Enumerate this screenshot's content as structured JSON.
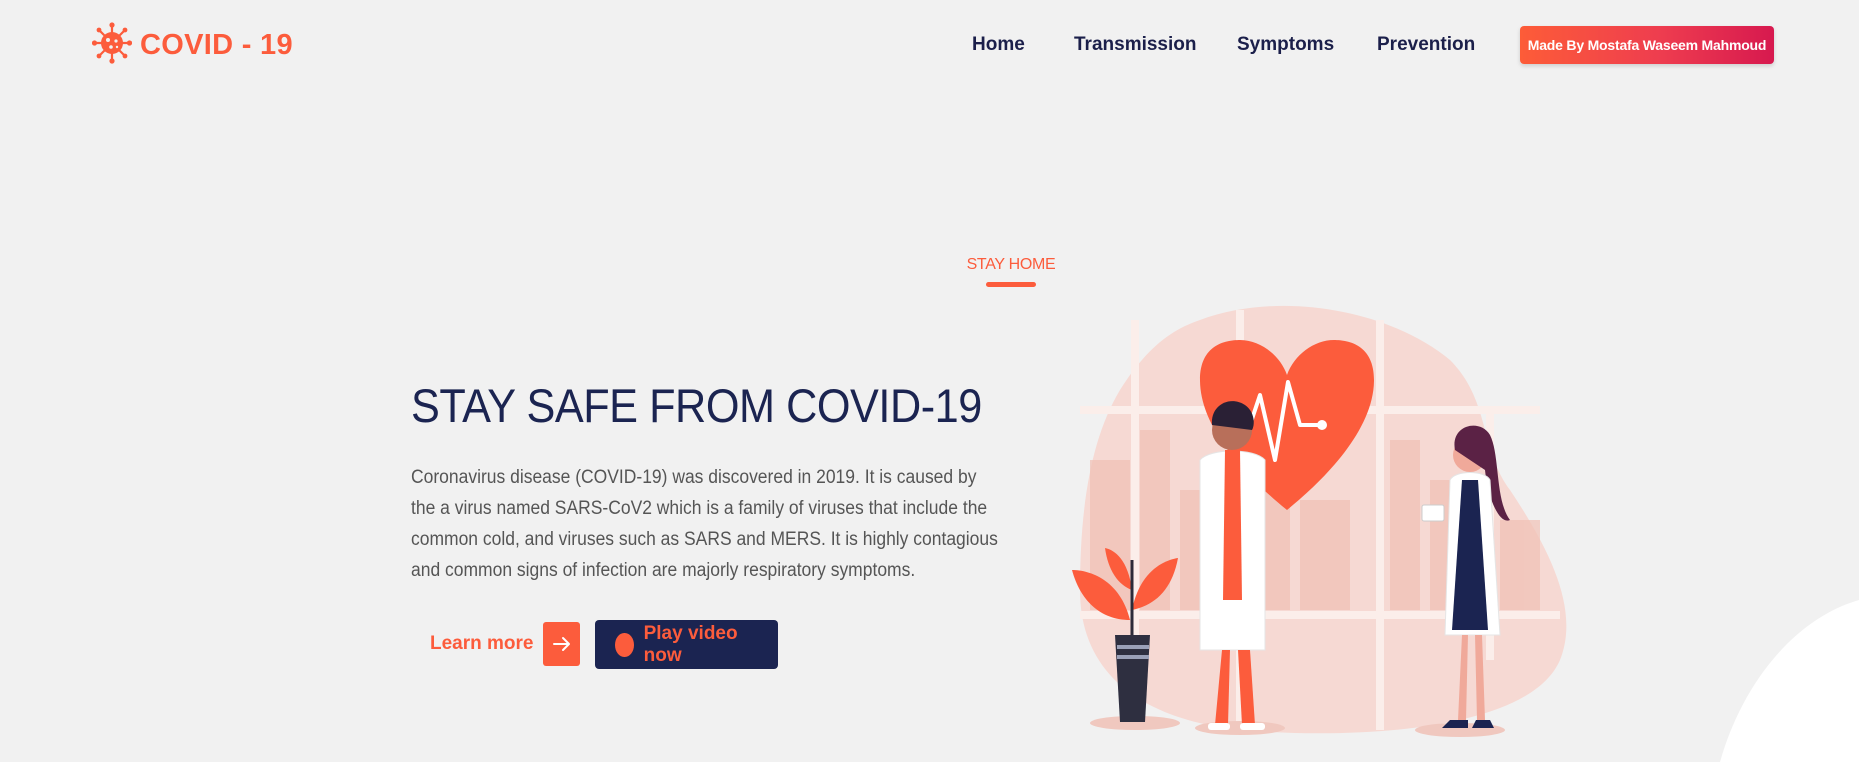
{
  "header": {
    "logo_text": "COVID - 19",
    "nav": [
      "Home",
      "Transmission",
      "Symptoms",
      "Prevention"
    ],
    "cta_label": "Made By Mostafa Waseem Mahmoud"
  },
  "hero": {
    "eyebrow": "STAY HOME",
    "title": "STAY SAFE FROM COVID-19",
    "description": "Coronavirus disease (COVID-19) was discovered in 2019. It is caused by the a virus named SARS-CoV2 which is a family of viruses that include the common cold, and viruses such as SARS and MERS. It is highly contagious and common signs of infection are majorly respiratory symptoms.",
    "learn_more_label": "Learn more",
    "play_video_label": "Play video now"
  },
  "colors": {
    "accent": "#fc5c3c",
    "navy": "#1b2451",
    "background": "#f1f1f1"
  },
  "icons": {
    "logo": "virus-icon",
    "learn_more": "arrow-right-icon",
    "play": "play-dot-icon"
  }
}
